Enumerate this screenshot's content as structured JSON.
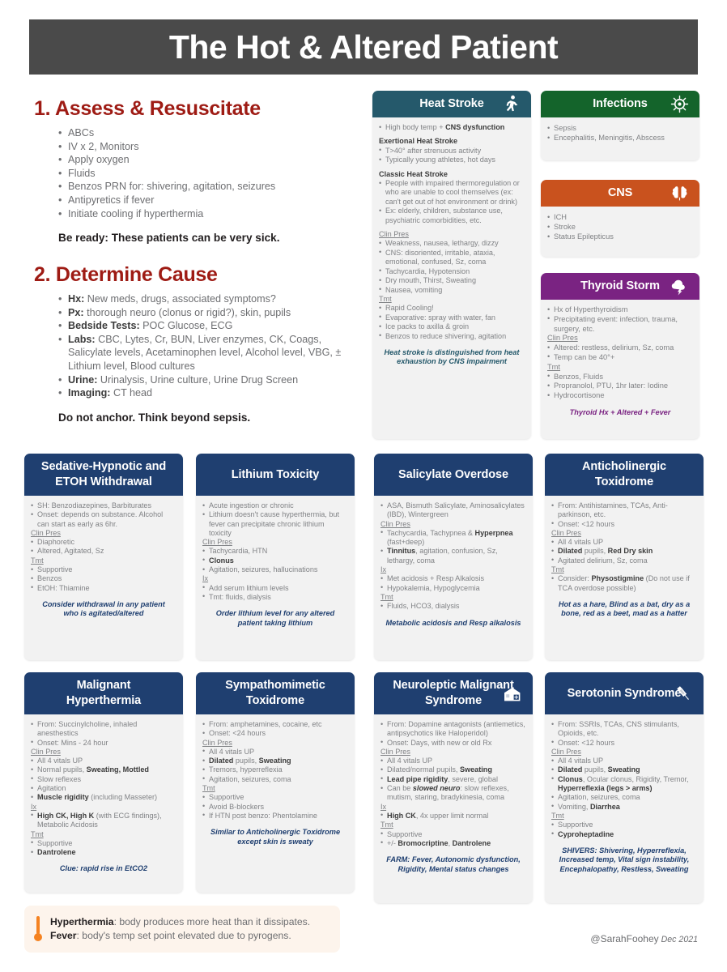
{
  "banner": {
    "title": "The Hot & Altered Patient"
  },
  "sections": [
    {
      "title": "1. Assess & Resuscitate",
      "items": [
        "ABCs",
        "IV x 2, Monitors",
        "Apply oxygen",
        "Fluids",
        "Benzos PRN for: shivering, agitation, seizures",
        "Antipyretics if fever",
        "Initiate cooling if hyperthermia"
      ],
      "tagline": "Be ready: These patients can be very sick."
    },
    {
      "title": "2. Determine Cause",
      "items": [
        {
          "label": "Hx:",
          "text": " New meds, drugs, associated symptoms?"
        },
        {
          "label": "Px:",
          "text": " thorough neuro (clonus or rigid?), skin, pupils"
        },
        {
          "label": "Bedside Tests:",
          "text": " POC Glucose, ECG"
        },
        {
          "label": "Labs:",
          "text": " CBC, Lytes, Cr, BUN, Liver enzymes, CK, Coags, Salicylate levels, Acetaminophen level, Alcohol level, VBG, ± Lithium level, Blood cultures"
        },
        {
          "label": "Urine:",
          "text": " Urinalysis, Urine culture, Urine Drug Screen"
        },
        {
          "label": "Imaging:",
          "text": " CT head"
        }
      ],
      "tagline": "Do not anchor. Think beyond sepsis."
    }
  ],
  "cards": {
    "heat_stroke": {
      "title": "Heat Stroke",
      "icon": "running-person-icon",
      "header_color": "#25596b",
      "footnote": "Heat stroke is distinguished from heat exhaustion by CNS impairment",
      "blocks": [
        {
          "type": "list",
          "items": [
            "High body temp + <b>CNS dysfunction</b>"
          ]
        },
        {
          "type": "sublabel",
          "text": "Exertional Heat Stroke"
        },
        {
          "type": "list",
          "items": [
            "T>40° after strenuous activity",
            "Typically young athletes, hot days"
          ]
        },
        {
          "type": "sublabel",
          "text": "Classic Heat Stroke"
        },
        {
          "type": "list",
          "items": [
            "People with impaired thermoregulation or who are unable to cool themselves (ex: can't get out of hot environment or drink)",
            "Ex: elderly, children, substance use, psychiatric comorbidities, etc."
          ]
        },
        {
          "type": "gap"
        },
        {
          "type": "uhead",
          "text": "Clin Pres"
        },
        {
          "type": "list",
          "items": [
            "Weakness, nausea, lethargy, dizzy",
            "CNS: disoriented, irritable, ataxia, emotional, confused, Sz, coma",
            "Tachycardia, Hypotension",
            "Dry mouth, Thirst, Sweating",
            "Nausea, vomiting"
          ]
        },
        {
          "type": "uhead",
          "text": "Tmt"
        },
        {
          "type": "list",
          "items": [
            "Rapid Cooling!",
            "Evaporative: spray with water, fan",
            "Ice packs to axilla & groin",
            "Benzos to reduce shivering, agitation"
          ]
        }
      ]
    },
    "infections": {
      "title": "Infections",
      "icon": "virus-icon",
      "header_color": "#14642b",
      "blocks": [
        {
          "type": "list",
          "items": [
            "Sepsis",
            "Encephalitis, Meningitis, Abscess"
          ]
        }
      ]
    },
    "cns": {
      "title": "CNS",
      "icon": "brain-icon",
      "header_color": "#c9521e",
      "blocks": [
        {
          "type": "list",
          "items": [
            "ICH",
            "Stroke",
            "Status Epilepticus"
          ]
        }
      ]
    },
    "thyroid_storm": {
      "title": "Thyroid Storm",
      "icon": "storm-cloud-icon",
      "header_color": "#7a2382",
      "footnote": "Thyroid Hx + Altered + Fever",
      "blocks": [
        {
          "type": "list",
          "items": [
            "Hx of Hyperthyroidism",
            "Precipitating event: infection, trauma, surgery, etc."
          ]
        },
        {
          "type": "uhead",
          "text": "Clin Pres"
        },
        {
          "type": "list",
          "items": [
            "Altered: restless, delirium, Sz, coma",
            "Temp can be 40°+"
          ]
        },
        {
          "type": "uhead",
          "text": "Tmt"
        },
        {
          "type": "list",
          "items": [
            "Benzos, Fluids",
            "Propranolol, PTU, 1hr later: Iodine",
            "Hydrocortisone"
          ]
        }
      ]
    },
    "sedative_hypnotic": {
      "title": "Sedative-Hypnotic and ETOH Withdrawal",
      "icon": null,
      "header_color": "#1f3f70",
      "footnote": "Consider withdrawal in any patient who is agitated/altered",
      "blocks": [
        {
          "type": "list",
          "items": [
            "SH: Benzodiazepines, Barbiturates",
            "Onset: depends on substance. Alcohol can start as early as 6hr."
          ]
        },
        {
          "type": "uhead",
          "text": "Clin Pres"
        },
        {
          "type": "list",
          "items": [
            "Diaphoretic",
            "Altered, Agitated, Sz"
          ]
        },
        {
          "type": "uhead",
          "text": "Tmt"
        },
        {
          "type": "list",
          "items": [
            "Supportive",
            "Benzos",
            "EtOH: Thiamine"
          ]
        }
      ]
    },
    "lithium_toxicity": {
      "title": "Lithium Toxicity",
      "icon": null,
      "header_color": "#1f3f70",
      "footnote": "Order lithium level for any altered patient taking lithium",
      "blocks": [
        {
          "type": "list",
          "items": [
            "Acute ingestion or chronic",
            "Lithium doesn't cause hyperthermia, but fever can precipitate chronic lithium toxicity"
          ]
        },
        {
          "type": "uhead",
          "text": "Clin Pres"
        },
        {
          "type": "list",
          "items": [
            "Tachycardia, HTN",
            "<b>Clonus</b>",
            "Agitation, seizures, hallucinations"
          ]
        },
        {
          "type": "uhead",
          "text": "Ix"
        },
        {
          "type": "list",
          "items": [
            "Add serum lithium levels",
            "Tmt: fluids, dialysis"
          ]
        }
      ]
    },
    "salicylate_overdose": {
      "title": "Salicylate Overdose",
      "icon": null,
      "header_color": "#1f3f70",
      "footnote": "Metabolic acidosis and Resp alkalosis",
      "blocks": [
        {
          "type": "list",
          "items": [
            "ASA, Bismuth Salicylate, Aminosalicylates (IBD), Wintergreen"
          ]
        },
        {
          "type": "uhead",
          "text": "Clin Pres"
        },
        {
          "type": "list",
          "items": [
            "Tachycardia, Tachypnea & <b>Hyperpnea</b> (fast+deep)",
            "<b>Tinnitus</b>, agitation, confusion, Sz, lethargy, coma"
          ]
        },
        {
          "type": "uhead",
          "text": "Ix"
        },
        {
          "type": "list",
          "items": [
            "Met acidosis + Resp Alkalosis",
            "Hypokalemia, Hypoglycemia"
          ]
        },
        {
          "type": "uhead",
          "text": "Tmt"
        },
        {
          "type": "list",
          "items": [
            "Fluids, HCO3, dialysis"
          ]
        }
      ]
    },
    "anticholinergic": {
      "title": "Anticholinergic Toxidrome",
      "icon": null,
      "header_color": "#1f3f70",
      "footnote": "Hot as a hare, Blind as a bat, dry as a bone, red as a beet, mad as a hatter",
      "blocks": [
        {
          "type": "list",
          "items": [
            "From: Antihistamines, TCAs, Anti-parkinson, etc.",
            "Onset: <12 hours"
          ]
        },
        {
          "type": "uhead",
          "text": "Clin Pres"
        },
        {
          "type": "list",
          "items": [
            "All 4 vitals UP",
            "<b>Dilated</b> pupils, <b>Red Dry skin</b>",
            "Agitated delirium, Sz, coma"
          ]
        },
        {
          "type": "uhead",
          "text": "Tmt"
        },
        {
          "type": "list",
          "items": [
            "Consider: <b>Physostigmine</b> (Do not use if TCA overdose possible)"
          ]
        }
      ]
    },
    "malignant_hyperthermia": {
      "title": "Malignant Hyperthermia",
      "icon": null,
      "header_color": "#1f3f70",
      "footnote": "Clue: rapid rise in EtCO2",
      "blocks": [
        {
          "type": "list",
          "items": [
            "From: Succinylcholine, inhaled anesthestics",
            "Onset: Mins - 24 hour"
          ]
        },
        {
          "type": "uhead",
          "text": "Clin Pres"
        },
        {
          "type": "list",
          "items": [
            "All 4 vitals UP",
            "Normal pupils, <b>Sweating, Mottled</b>",
            "Slow reflexes",
            "Agitation",
            "<b>Muscle rigidity</b> (including Masseter)"
          ]
        },
        {
          "type": "uhead",
          "text": "Ix"
        },
        {
          "type": "list",
          "items": [
            "<b>High CK, High K</b> (with ECG findings), Metabolic Acidosis"
          ]
        },
        {
          "type": "uhead",
          "text": "Tmt"
        },
        {
          "type": "list",
          "items": [
            "Supportive",
            "<b>Dantrolene</b>"
          ]
        }
      ]
    },
    "sympathomimetic": {
      "title": "Sympathomimetic Toxidrome",
      "icon": null,
      "header_color": "#1f3f70",
      "footnote": "Similar to Anticholinergic Toxidrome except skin is sweaty",
      "blocks": [
        {
          "type": "list",
          "items": [
            "From: amphetamines, cocaine, etc",
            "Onset: <24 hours"
          ]
        },
        {
          "type": "uhead",
          "text": "Clin Pres"
        },
        {
          "type": "list",
          "items": [
            "All 4 vitals UP",
            "<b>Dilated</b> pupils, <b>Sweating</b>",
            "Tremors, hyperreflexia",
            "Agitation, seizures, coma"
          ]
        },
        {
          "type": "uhead",
          "text": "Tmt"
        },
        {
          "type": "list",
          "items": [
            "Supportive",
            "Avoid B-blockers",
            "If HTN post benzo: Phentolamine"
          ]
        }
      ]
    },
    "nms": {
      "title": "Neuroleptic Malignant Syndrome",
      "icon": "pharmacy-icon",
      "header_color": "#1f3f70",
      "footnote": "FARM: Fever, Autonomic dysfunction, Rigidity, Mental status changes",
      "blocks": [
        {
          "type": "list",
          "items": [
            "From: Dopamine antagonists (antiemetics, antipsychotics like Haloperidol)",
            "Onset: Days, with new or old Rx"
          ]
        },
        {
          "type": "uhead",
          "text": "Clin Pres"
        },
        {
          "type": "list",
          "items": [
            "All 4 vitals UP",
            "Dilated/normal pupils, <b>Sweating</b>",
            "<b>Lead pipe rigidity</b>, severe, global",
            "Can be <i>slowed neuro</i>: slow reflexes, mutism, staring, bradykinesia, coma"
          ]
        },
        {
          "type": "uhead",
          "text": "Ix"
        },
        {
          "type": "list",
          "items": [
            "<b>High CK</b>, 4x upper limit normal"
          ]
        },
        {
          "type": "uhead",
          "text": "Tmt"
        },
        {
          "type": "list",
          "items": [
            "Supportive",
            "+/- <b>Bromocriptine</b>, <b>Dantrolene</b>"
          ]
        }
      ]
    },
    "serotonin_syndrome": {
      "title": "Serotonin Syndrome",
      "icon": "syringe-icon",
      "header_color": "#1f3f70",
      "footnote": "SHIVERS: Shivering, Hyperreflexia, Increased temp, Vital sign instability, Encephalopathy, Restless, Sweating",
      "blocks": [
        {
          "type": "list",
          "items": [
            "From: SSRIs, TCAs, CNS stimulants, Opioids, etc.",
            "Onset: <12 hours"
          ]
        },
        {
          "type": "uhead",
          "text": "Clin Pres"
        },
        {
          "type": "list",
          "items": [
            "All 4 vitals UP",
            "<b>Dilated</b> pupils, <b>Sweating</b>",
            "<b>Clonus</b>, Ocular clonus, Rigidity, Tremor, <b>Hyperreflexia (legs > arms)</b>",
            "Agitation, seizures, coma",
            "Vomiting, <b>Diarrhea</b>"
          ]
        },
        {
          "type": "uhead",
          "text": "Tmt"
        },
        {
          "type": "list",
          "items": [
            "Supportive",
            "<b>Cyproheptadine</b>"
          ]
        }
      ]
    }
  },
  "footer": {
    "icon": "thermometer-icon",
    "line1_label": "Hyperthermia",
    "line1_text": ": body produces more heat than it dissipates.",
    "line2_label": "Fever",
    "line2_text": ": body's temp set point elevated due to pyrogens.",
    "credit": "@SarahFoohey",
    "date": "Dec 2021"
  }
}
